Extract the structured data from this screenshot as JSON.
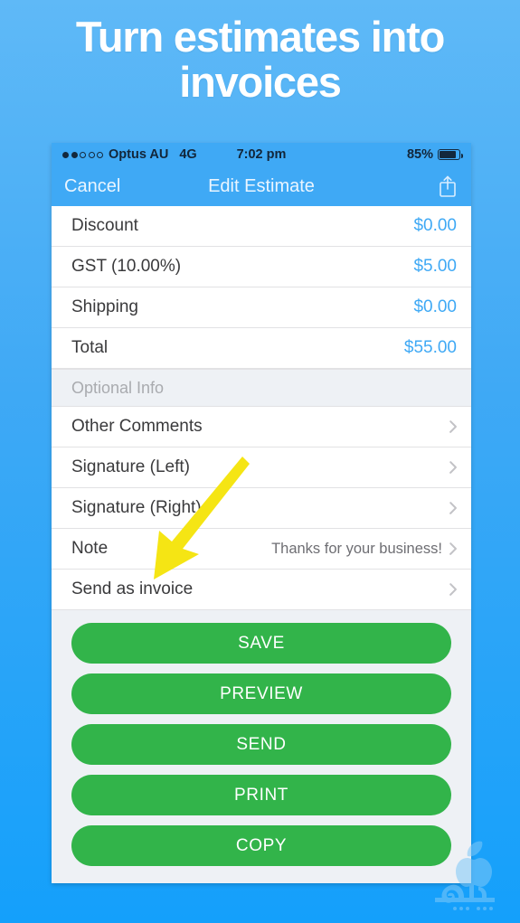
{
  "promo": {
    "headline": "Turn estimates into invoices"
  },
  "status_bar": {
    "signal_dots_filled": 2,
    "signal_dots_total": 5,
    "carrier": "Optus AU",
    "network": "4G",
    "time": "7:02 pm",
    "battery_percent": "85%",
    "battery_level": 85
  },
  "nav": {
    "cancel_label": "Cancel",
    "title": "Edit Estimate",
    "share_icon": "share-icon"
  },
  "totals_rows": [
    {
      "label": "Discount",
      "amount": "$0.00"
    },
    {
      "label": "GST (10.00%)",
      "amount": "$5.00"
    },
    {
      "label": "Shipping",
      "amount": "$0.00"
    },
    {
      "label": "Total",
      "amount": "$55.00"
    }
  ],
  "optional_section": {
    "header": "Optional Info",
    "rows": [
      {
        "label": "Other Comments",
        "value": ""
      },
      {
        "label": "Signature (Left)",
        "value": ""
      },
      {
        "label": "Signature (Right)",
        "value": ""
      },
      {
        "label": "Note",
        "value": "Thanks for your business!"
      },
      {
        "label": "Send as invoice",
        "value": ""
      }
    ]
  },
  "actions": [
    {
      "label": "SAVE"
    },
    {
      "label": "PREVIEW"
    },
    {
      "label": "SEND"
    },
    {
      "label": "PRINT"
    },
    {
      "label": "COPY"
    }
  ],
  "annotation": {
    "arrow": "yellow-arrow-pointing-to-send-as-invoice"
  },
  "colors": {
    "background_top": "#5fb9f7",
    "background_bottom": "#14a0fb",
    "nav_blue": "#3fa9f5",
    "amount_blue": "#3fa9f5",
    "button_green": "#32b44a",
    "arrow_yellow": "#f5e514",
    "section_gray": "#eef1f5"
  }
}
